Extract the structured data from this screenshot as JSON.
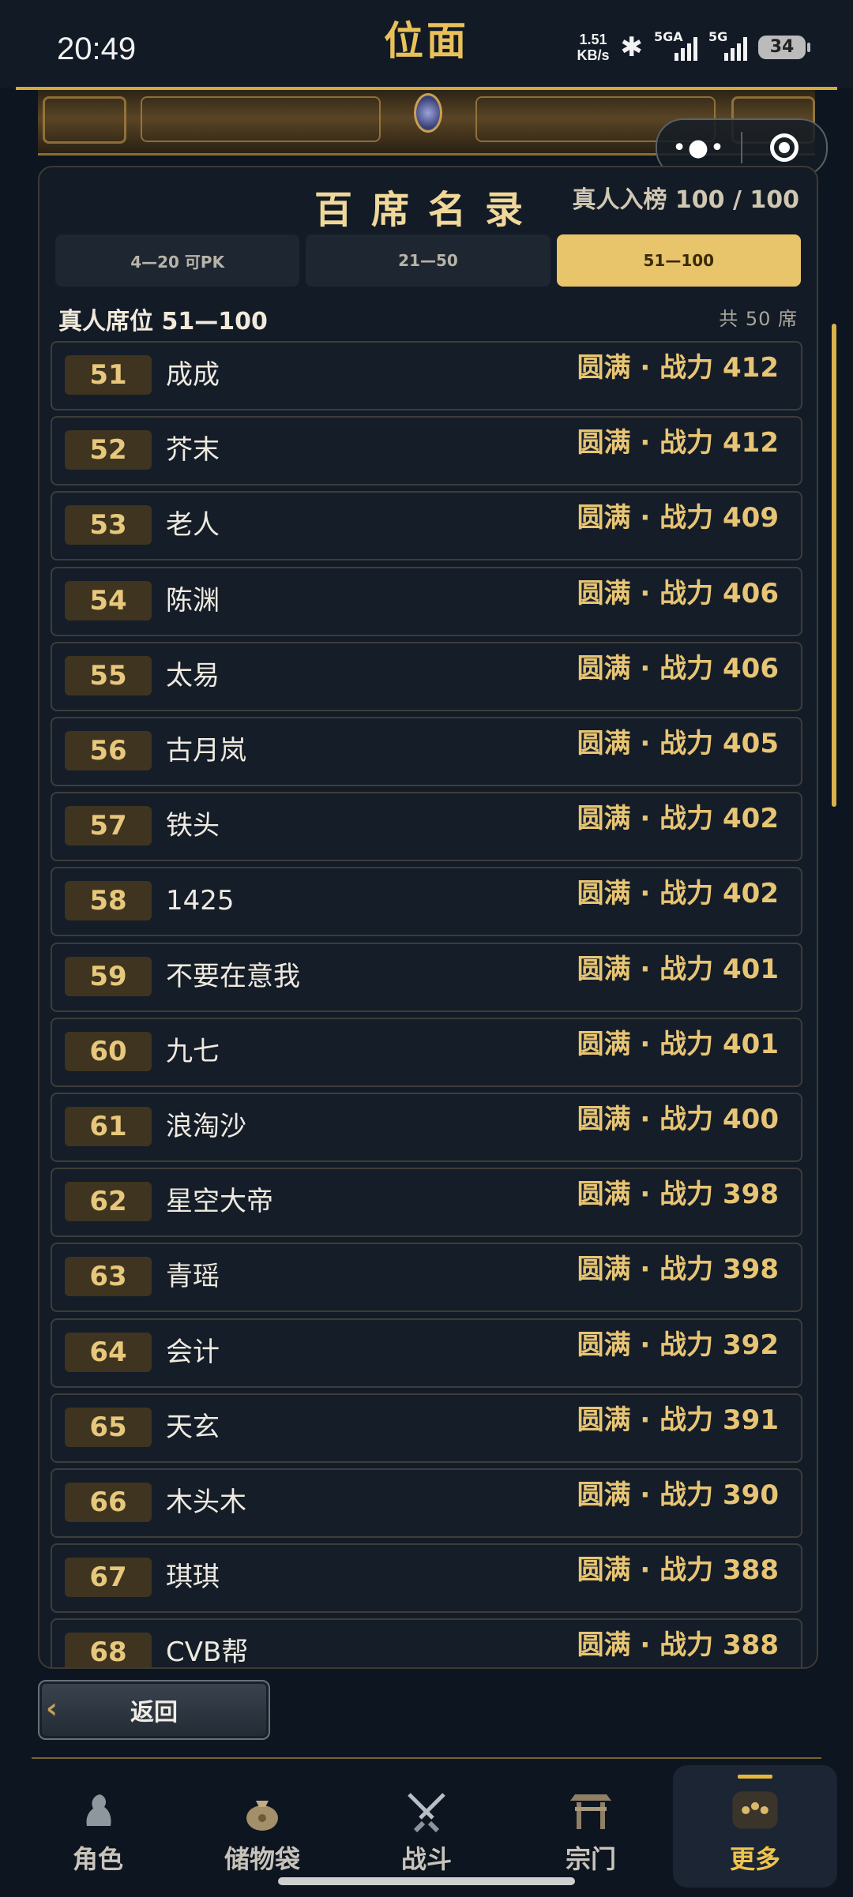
{
  "status_bar": {
    "time": "20:49",
    "app_title": "位面",
    "net_speed_value": "1.51",
    "net_speed_unit": "KB/s",
    "sim1_label": "5GA",
    "sim2_label": "5G",
    "battery": "34"
  },
  "panel": {
    "title": "百席名录",
    "count": "真人入榜 100 / 100",
    "tabs": [
      {
        "label": "4—20 可PK",
        "active": false
      },
      {
        "label": "21—50",
        "active": false
      },
      {
        "label": "51—100",
        "active": true
      }
    ],
    "subheader_left": "真人席位 51—100",
    "subheader_right": "共 50 席",
    "rows": [
      {
        "rank": "51",
        "name": "成成",
        "power": "圆满 · 战力 412"
      },
      {
        "rank": "52",
        "name": "芥末",
        "power": "圆满 · 战力 412"
      },
      {
        "rank": "53",
        "name": "老人",
        "power": "圆满 · 战力 409"
      },
      {
        "rank": "54",
        "name": "陈渊",
        "power": "圆满 · 战力 406"
      },
      {
        "rank": "55",
        "name": "太易",
        "power": "圆满 · 战力 406"
      },
      {
        "rank": "56",
        "name": "古月岚",
        "power": "圆满 · 战力 405"
      },
      {
        "rank": "57",
        "name": "铁头",
        "power": "圆满 · 战力 402"
      },
      {
        "rank": "58",
        "name": "1425",
        "power": "圆满 · 战力 402"
      },
      {
        "rank": "59",
        "name": "不要在意我",
        "power": "圆满 · 战力 401"
      },
      {
        "rank": "60",
        "name": "九七",
        "power": "圆满 · 战力 401"
      },
      {
        "rank": "61",
        "name": "浪淘沙",
        "power": "圆满 · 战力 400"
      },
      {
        "rank": "62",
        "name": "星空大帝",
        "power": "圆满 · 战力 398"
      },
      {
        "rank": "63",
        "name": "青瑶",
        "power": "圆满 · 战力 398"
      },
      {
        "rank": "64",
        "name": "会计",
        "power": "圆满 · 战力 392"
      },
      {
        "rank": "65",
        "name": "天玄",
        "power": "圆满 · 战力 391"
      },
      {
        "rank": "66",
        "name": "木头木",
        "power": "圆满 · 战力 390"
      },
      {
        "rank": "67",
        "name": "琪琪",
        "power": "圆满 · 战力 388"
      },
      {
        "rank": "68",
        "name": "CVB帮",
        "power": "圆满 · 战力 388"
      }
    ]
  },
  "return_label": "返回",
  "nav": [
    {
      "label": "角色",
      "icon": "character-icon"
    },
    {
      "label": "储物袋",
      "icon": "storage-bag-icon"
    },
    {
      "label": "战斗",
      "icon": "crossed-swords-icon"
    },
    {
      "label": "宗门",
      "icon": "sect-gate-icon"
    },
    {
      "label": "更多",
      "icon": "more-icon",
      "active": true
    }
  ]
}
